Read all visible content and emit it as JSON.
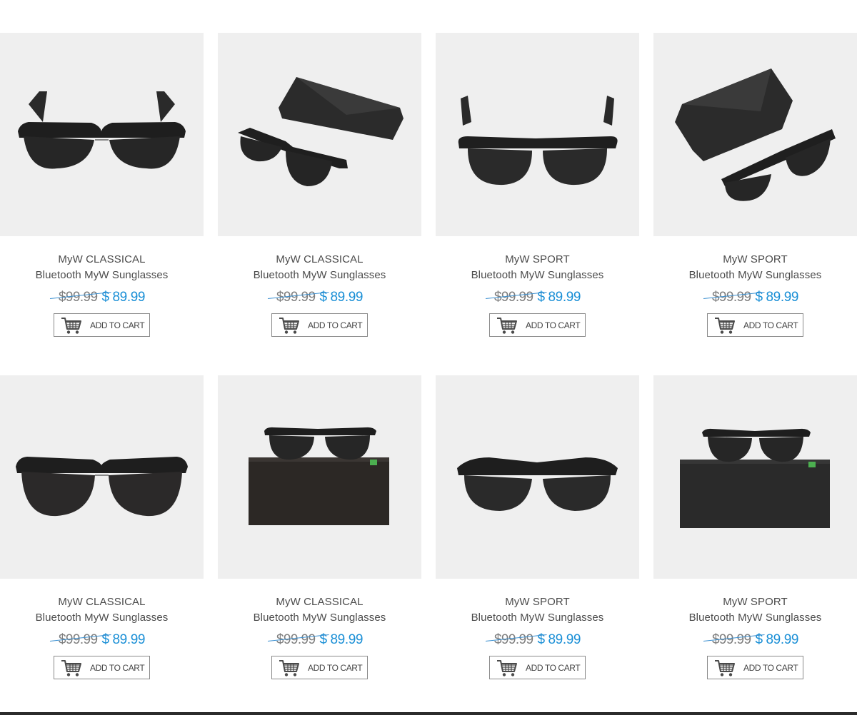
{
  "products": [
    {
      "line1": "MyW CLASSICAL",
      "line2": "Bluetooth MyW Sunglasses",
      "old_price": "$99.99",
      "new_price": "$ 89.99",
      "cart_label": "ADD TO CART",
      "image": "classical-front"
    },
    {
      "line1": "MyW CLASSICAL",
      "line2": "Bluetooth MyW Sunglasses",
      "old_price": "$99.99",
      "new_price": "$ 89.99",
      "cart_label": "ADD TO CART",
      "image": "classical-with-case"
    },
    {
      "line1": "MyW SPORT",
      "line2": "Bluetooth MyW Sunglasses",
      "old_price": "$99.99",
      "new_price": "$ 89.99",
      "cart_label": "ADD TO CART",
      "image": "sport-front"
    },
    {
      "line1": "MyW SPORT",
      "line2": "Bluetooth MyW Sunglasses",
      "old_price": "$99.99",
      "new_price": "$ 89.99",
      "cart_label": "ADD TO CART",
      "image": "sport-with-case"
    },
    {
      "line1": "MyW CLASSICAL",
      "line2": "Bluetooth MyW Sunglasses",
      "old_price": "$99.99",
      "new_price": "$ 89.99",
      "cart_label": "ADD TO CART",
      "image": "classical-front-flat"
    },
    {
      "line1": "MyW CLASSICAL",
      "line2": "Bluetooth MyW Sunglasses",
      "old_price": "$99.99",
      "new_price": "$ 89.99",
      "cart_label": "ADD TO CART",
      "image": "classical-on-box"
    },
    {
      "line1": "MyW SPORT",
      "line2": "Bluetooth MyW Sunglasses",
      "old_price": "$99.99",
      "new_price": "$ 89.99",
      "cart_label": "ADD TO CART",
      "image": "sport-front-flat"
    },
    {
      "line1": "MyW SPORT",
      "line2": "Bluetooth MyW Sunglasses",
      "old_price": "$99.99",
      "new_price": "$ 89.99",
      "cart_label": "ADD TO CART",
      "image": "sport-on-box"
    }
  ],
  "colors": {
    "card_background": "#efefef",
    "old_price": "#7d7d7d",
    "new_price": "#1a8fd6",
    "strike": "#3a8fd0",
    "button_border": "#8a8a8a",
    "text": "#4b4b4b"
  },
  "icons": {
    "cart": "shopping-cart-icon"
  }
}
